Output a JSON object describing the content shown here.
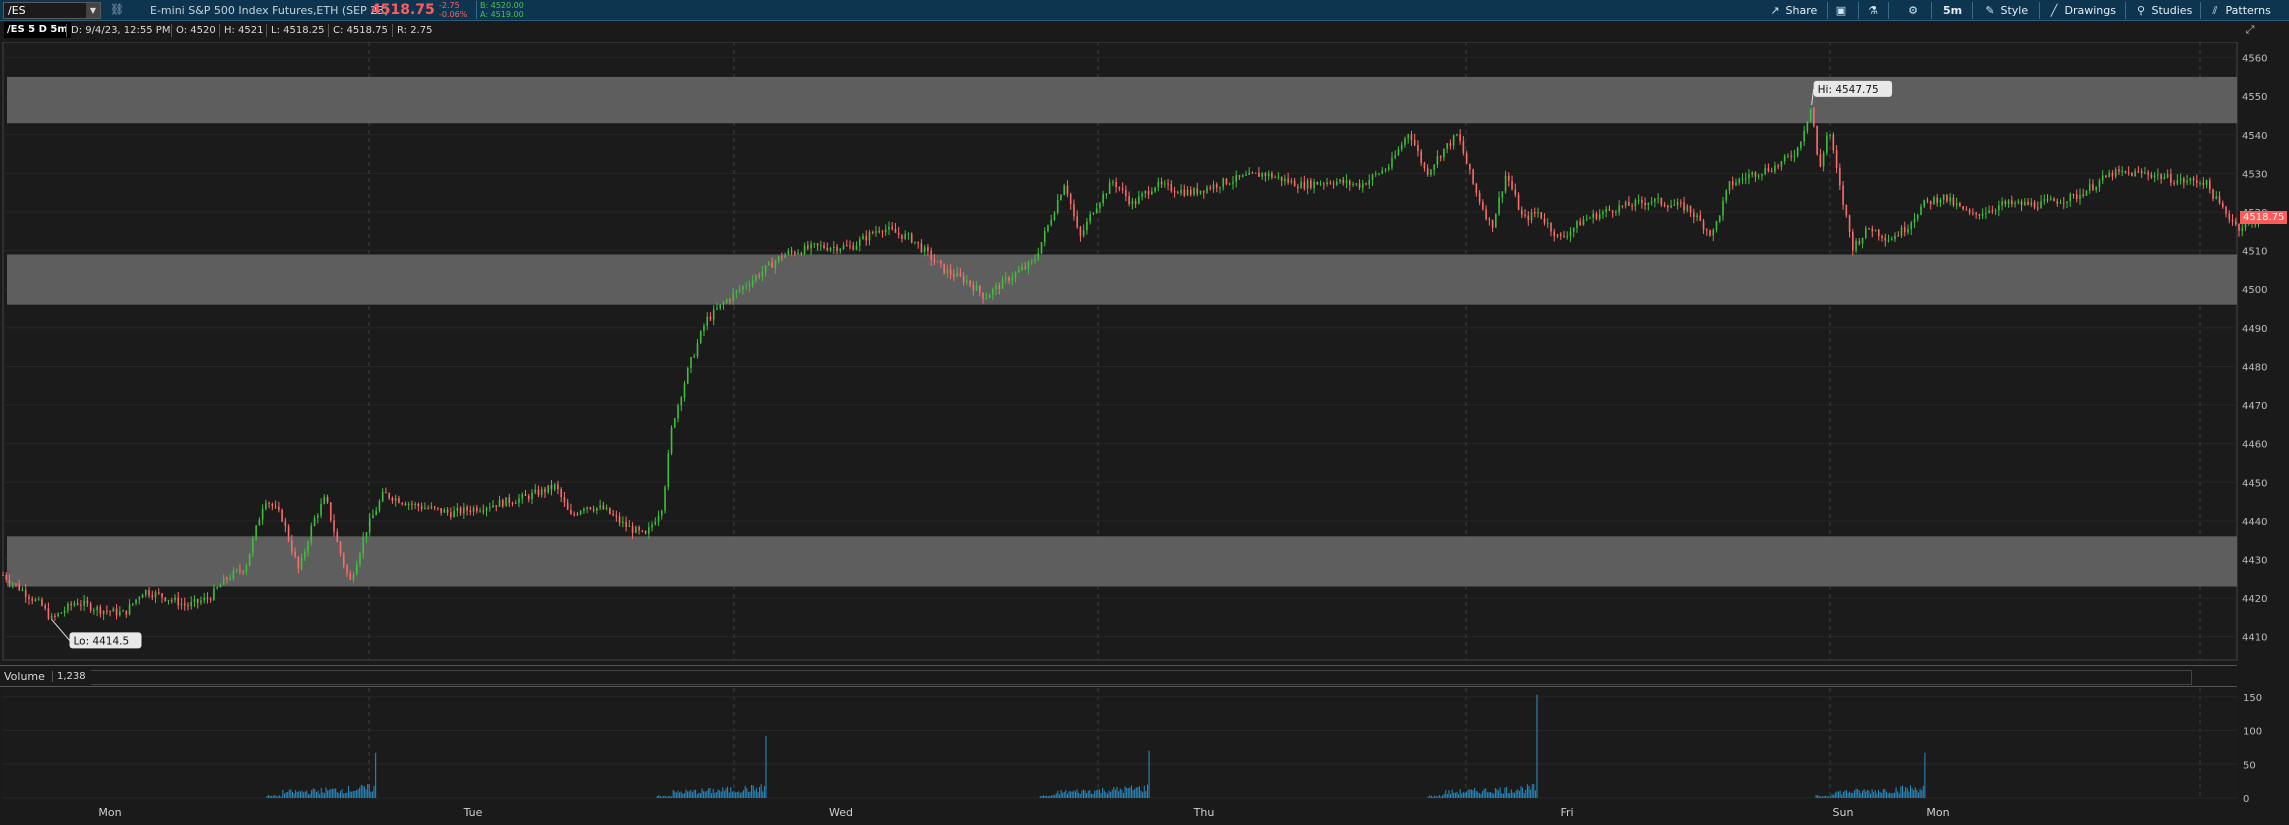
{
  "toolbar": {
    "symbol": "/ES",
    "instrument_name": "E-mini S&P 500 Index Futures,ETH (SEP 23)",
    "last_price": "4518.75",
    "net_change": "-2.75",
    "net_change_pct": "-0.06%",
    "bid": "B: 4520.00",
    "ask": "A: 4519.00",
    "share_label": "Share",
    "timeframe_label": "5m",
    "style_label": "Style",
    "drawings_label": "Drawings",
    "studies_label": "Studies",
    "patterns_label": "Patterns"
  },
  "info": {
    "study_title": "/ES 5 D 5m",
    "date": "D: 9/4/23, 12:55 PM",
    "open": "O: 4520",
    "high": "H: 4521",
    "low": "L: 4518.25",
    "close": "C: 4518.75",
    "range": "R: 2.75"
  },
  "volume_panel": {
    "label": "Volume",
    "value": "1,238"
  },
  "colors": {
    "up": "#3fbf3f",
    "down": "#ff6b6b",
    "zone": "#6a6a6a",
    "volume": "#2b8fc7",
    "last_price_tag": "#ff5b5b"
  },
  "chart_data": [
    {
      "type": "candlestick",
      "title": "/ES 5 D 5m",
      "y_axis_side": "right",
      "ylim": [
        4405,
        4563
      ],
      "yticks": [
        4410,
        4420,
        4430,
        4440,
        4450,
        4460,
        4470,
        4480,
        4490,
        4500,
        4510,
        4520,
        4530,
        4540,
        4550,
        4560
      ],
      "x_tick_labels": [
        "Mon",
        "Tue",
        "Wed",
        "Thu",
        "Fri",
        "Sun",
        "Mon"
      ],
      "day_boundaries": [
        "Mon",
        "Tue",
        "Wed",
        "Thu",
        "Fri",
        "Sun",
        "Mon"
      ],
      "grid": true,
      "high_annotation": "Hi: 4547.75",
      "low_annotation": "Lo: 4414.5",
      "last_price_tag": "4518.75",
      "zones": [
        {
          "from": 4543,
          "to": 4555
        },
        {
          "from": 4496,
          "to": 4509
        },
        {
          "from": 4423,
          "to": 4436
        }
      ],
      "price_path": [
        [
          0.0,
          4426
        ],
        [
          0.01,
          4421
        ],
        [
          0.016,
          4418
        ],
        [
          0.02,
          4414.5
        ],
        [
          0.03,
          4419
        ],
        [
          0.04,
          4417
        ],
        [
          0.05,
          4416
        ],
        [
          0.058,
          4422
        ],
        [
          0.068,
          4420
        ],
        [
          0.076,
          4418
        ],
        [
          0.085,
          4420
        ],
        [
          0.092,
          4425
        ],
        [
          0.1,
          4428
        ],
        [
          0.108,
          4446
        ],
        [
          0.115,
          4441
        ],
        [
          0.122,
          4427
        ],
        [
          0.128,
          4440
        ],
        [
          0.133,
          4446
        ],
        [
          0.138,
          4434
        ],
        [
          0.143,
          4424
        ],
        [
          0.15,
          4438
        ],
        [
          0.157,
          4447
        ],
        [
          0.17,
          4444
        ],
        [
          0.185,
          4442
        ],
        [
          0.2,
          4444
        ],
        [
          0.215,
          4446
        ],
        [
          0.228,
          4449
        ],
        [
          0.234,
          4441
        ],
        [
          0.24,
          4444
        ],
        [
          0.248,
          4443
        ],
        [
          0.256,
          4439
        ],
        [
          0.265,
          4436
        ],
        [
          0.272,
          4444
        ],
        [
          0.276,
          4465
        ],
        [
          0.283,
          4480
        ],
        [
          0.29,
          4492
        ],
        [
          0.3,
          4498
        ],
        [
          0.31,
          4503
        ],
        [
          0.322,
          4509
        ],
        [
          0.335,
          4511
        ],
        [
          0.35,
          4511
        ],
        [
          0.362,
          4516
        ],
        [
          0.375,
          4513
        ],
        [
          0.388,
          4505
        ],
        [
          0.398,
          4502
        ],
        [
          0.405,
          4498
        ],
        [
          0.415,
          4503
        ],
        [
          0.425,
          4507
        ],
        [
          0.432,
          4518
        ],
        [
          0.438,
          4528
        ],
        [
          0.444,
          4513
        ],
        [
          0.45,
          4521
        ],
        [
          0.458,
          4528
        ],
        [
          0.466,
          4522
        ],
        [
          0.475,
          4527
        ],
        [
          0.49,
          4525
        ],
        [
          0.505,
          4528
        ],
        [
          0.52,
          4530
        ],
        [
          0.535,
          4527
        ],
        [
          0.548,
          4528
        ],
        [
          0.56,
          4527
        ],
        [
          0.572,
          4532
        ],
        [
          0.58,
          4541
        ],
        [
          0.587,
          4530
        ],
        [
          0.594,
          4536
        ],
        [
          0.6,
          4540
        ],
        [
          0.607,
          4526
        ],
        [
          0.614,
          4516
        ],
        [
          0.62,
          4530
        ],
        [
          0.627,
          4518
        ],
        [
          0.633,
          4520
        ],
        [
          0.642,
          4513
        ],
        [
          0.652,
          4518
        ],
        [
          0.665,
          4521
        ],
        [
          0.68,
          4523
        ],
        [
          0.695,
          4521
        ],
        [
          0.705,
          4514
        ],
        [
          0.712,
          4527
        ],
        [
          0.722,
          4530
        ],
        [
          0.732,
          4532
        ],
        [
          0.74,
          4536
        ],
        [
          0.746,
          4547.75
        ],
        [
          0.749,
          4530
        ],
        [
          0.753,
          4542
        ],
        [
          0.758,
          4525
        ],
        [
          0.763,
          4511
        ],
        [
          0.77,
          4516
        ],
        [
          0.778,
          4513
        ],
        [
          0.785,
          4516
        ],
        [
          0.792,
          4522
        ],
        [
          0.8,
          4524
        ],
        [
          0.812,
          4519
        ],
        [
          0.825,
          4522
        ],
        [
          0.84,
          4522
        ],
        [
          0.855,
          4524
        ],
        [
          0.87,
          4530
        ],
        [
          0.885,
          4530
        ],
        [
          0.898,
          4528
        ],
        [
          0.908,
          4528
        ],
        [
          0.914,
          4522
        ],
        [
          0.922,
          4516
        ],
        [
          0.93,
          4518
        ],
        [
          0.937,
          4519
        ]
      ]
    },
    {
      "type": "bar",
      "title": "Volume",
      "y_axis_side": "right",
      "ylim": [
        0,
        160
      ],
      "yticks": [
        0,
        50,
        100,
        150
      ],
      "spikes": [
        {
          "x": 0.154,
          "value": 67
        },
        {
          "x": 0.315,
          "value": 92
        },
        {
          "x": 0.473,
          "value": 70
        },
        {
          "x": 0.633,
          "value": 153
        },
        {
          "x": 0.793,
          "value": 67
        }
      ]
    }
  ]
}
